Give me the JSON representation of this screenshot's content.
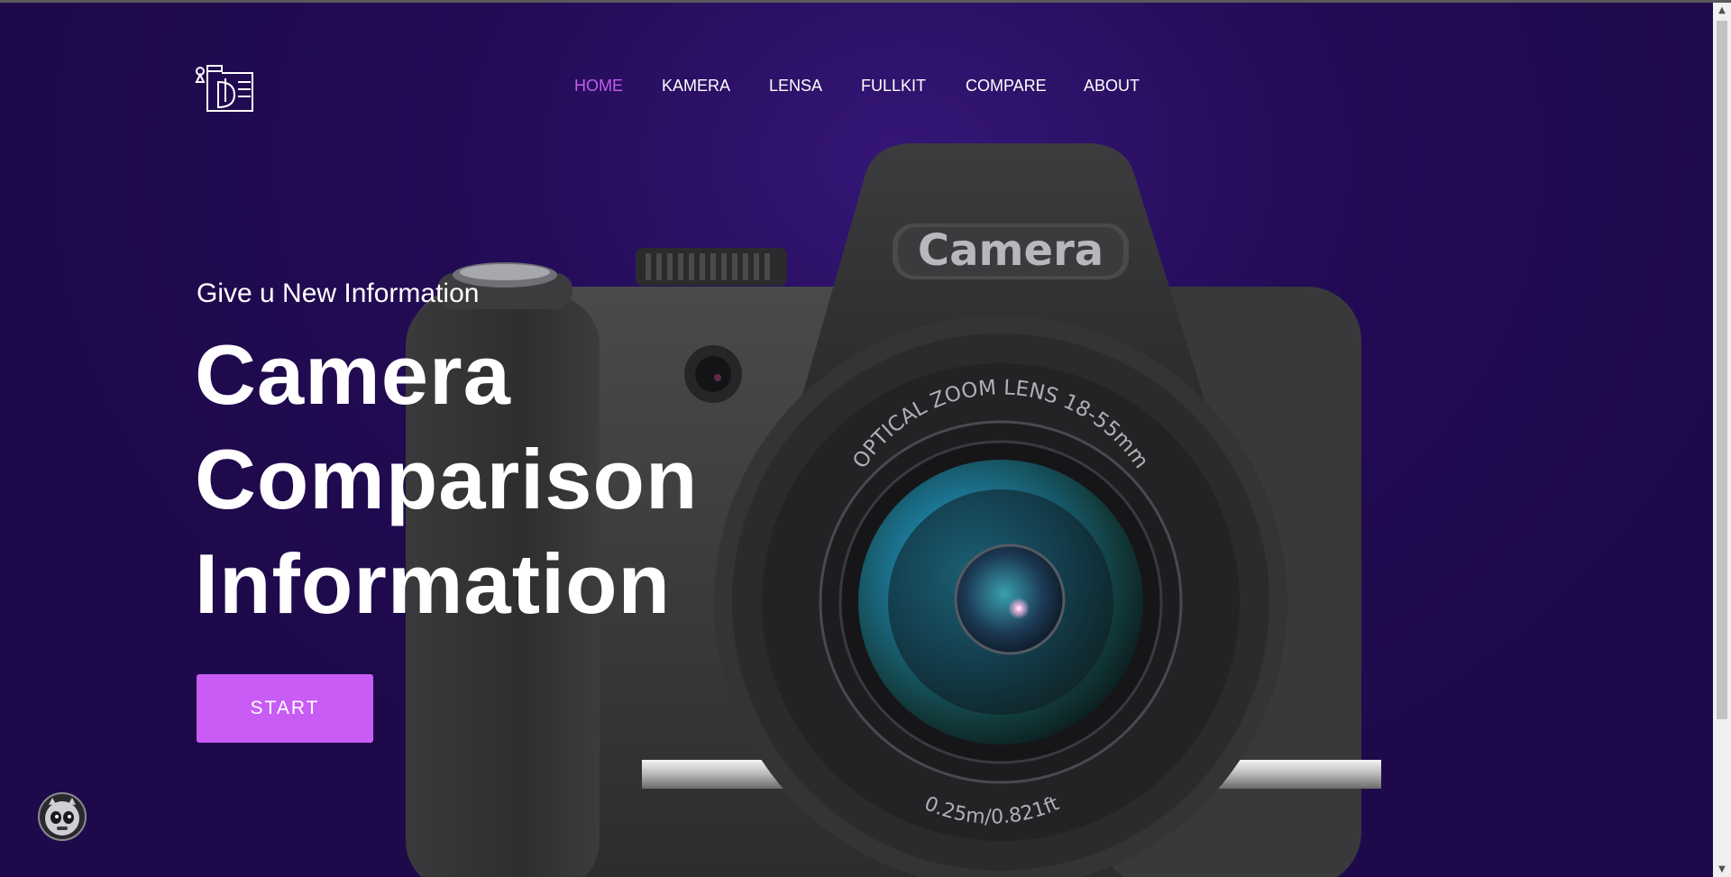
{
  "nav": {
    "items": [
      {
        "label": "HOME",
        "active": true
      },
      {
        "label": "KAMERA",
        "active": false
      },
      {
        "label": "LENSA",
        "active": false
      },
      {
        "label": "FULLKIT",
        "active": false
      },
      {
        "label": "COMPARE",
        "active": false
      },
      {
        "label": "ABOUT",
        "active": false
      }
    ]
  },
  "hero": {
    "subtitle": "Give u New Information",
    "headline": [
      "Camera",
      "Comparison",
      "Information"
    ],
    "start_label": "START"
  },
  "camera_illustration": {
    "badge_text": "Camera",
    "lens_ring_text": "OPTICAL ZOOM LENS 18-55mm",
    "focus_text": "0.25m/0.821ft"
  },
  "colors": {
    "background": "#1e0a4a",
    "accent": "#c85cf5",
    "active_nav": "#c35cf0",
    "text": "#ffffff"
  },
  "icons": {
    "logo": "camera-logo-icon",
    "widget": "robot-avatar-icon"
  }
}
